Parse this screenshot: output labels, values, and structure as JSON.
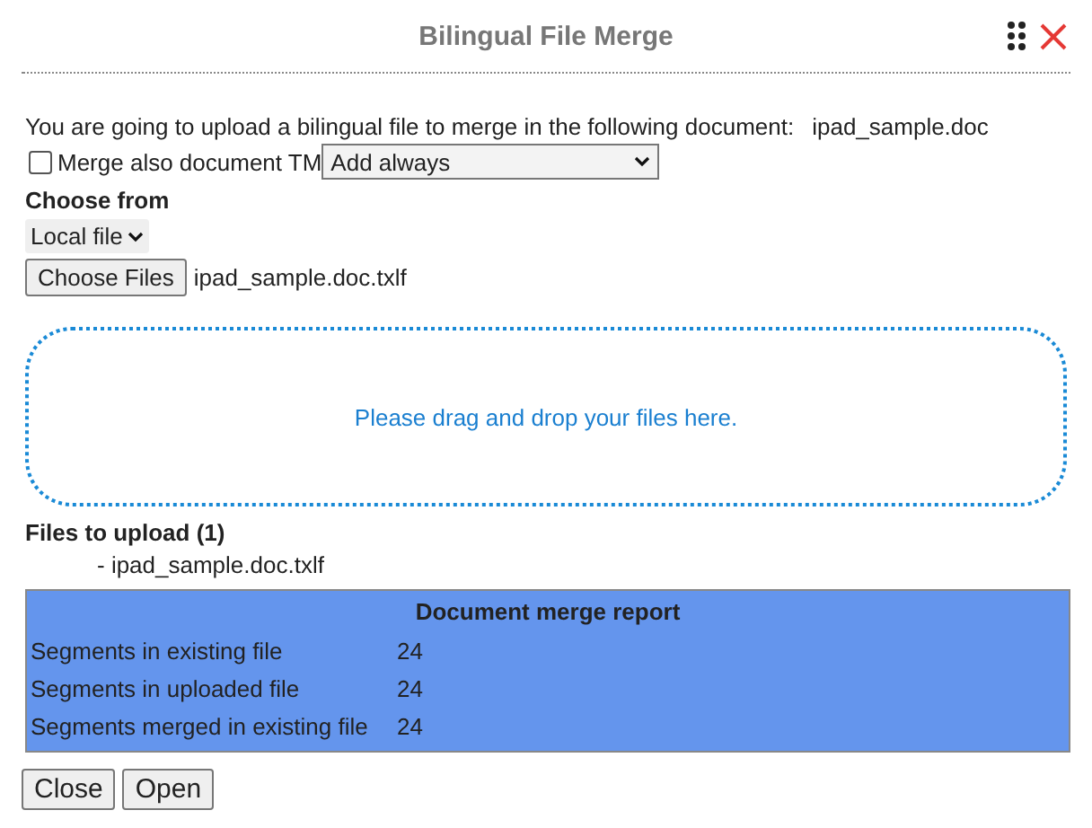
{
  "window": {
    "title": "Bilingual File Merge"
  },
  "intro": {
    "text": "You are going to upload a bilingual file to merge in the following document:",
    "document": "ipad_sample.doc"
  },
  "merge_tm": {
    "label": "Merge also document TM",
    "checked": false,
    "mode": "Add always"
  },
  "choose_from": {
    "heading": "Choose from",
    "source": "Local file",
    "button": "Choose Files",
    "file_name": "ipad_sample.doc.txlf"
  },
  "dropzone": {
    "text": "Please drag and drop your files here."
  },
  "files_to_upload": {
    "heading": "Files to upload (1)",
    "items": [
      "- ipad_sample.doc.txlf"
    ]
  },
  "report": {
    "title": "Document merge report",
    "rows": [
      {
        "label": "Segments in existing file",
        "value": "24"
      },
      {
        "label": "Segments in uploaded file",
        "value": "24"
      },
      {
        "label": "Segments merged in existing file",
        "value": "24"
      }
    ]
  },
  "buttons": [
    "Close",
    "Open"
  ]
}
